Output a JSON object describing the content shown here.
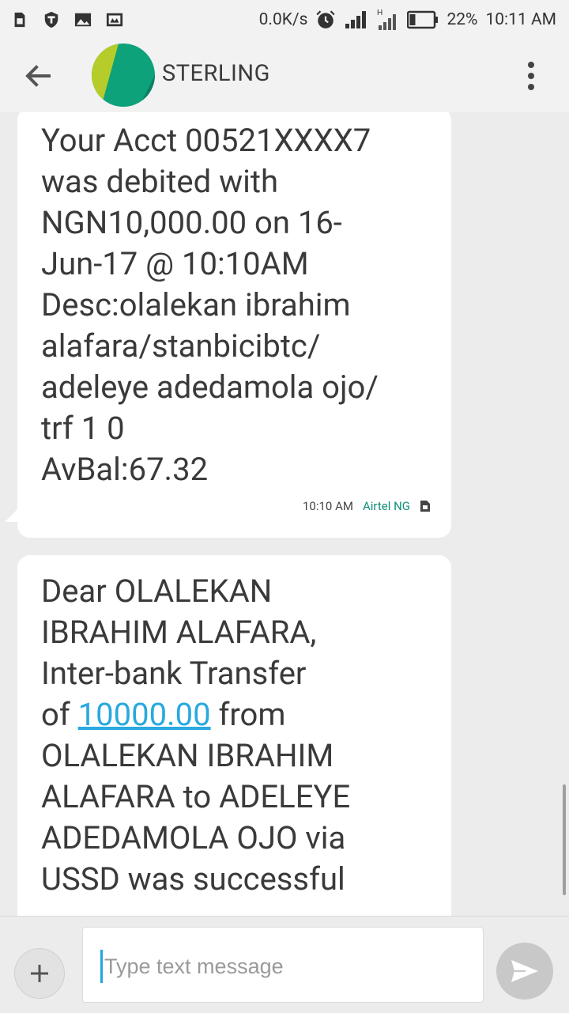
{
  "status_bar": {
    "net_speed": "0.0K/s",
    "battery_pct": "22%",
    "time": "10:11 AM",
    "icons": [
      "sim-icon",
      "shield-icon",
      "image-icon",
      "message-icon",
      "alarm-icon",
      "signal-icon",
      "signal-h-icon",
      "battery-icon"
    ]
  },
  "toolbar": {
    "title": "STERLING",
    "back_icon": "arrow-back-icon",
    "menu_icon": "more-vertical-icon"
  },
  "messages": [
    {
      "lines": [
        "Your Acct 00521XXXX7",
        "was debited with",
        "NGN10,000.00 on 16-",
        "Jun-17 @ 10:10AM",
        "Desc:olalekan ibrahim",
        "alafara/stanbicibtc/",
        "adeleye adedamola ojo/",
        "trf 1 0",
        "AvBal:67.32"
      ],
      "time": "10:10 AM",
      "carrier": "Airtel NG"
    },
    {
      "lines": [
        "Dear OLALEKAN",
        "IBRAHIM ALAFARA,",
        "Inter-bank Transfer"
      ],
      "line4_pre": "of ",
      "line4_link": "10000.00",
      "line4_post": " from",
      "lines_after": [
        "OLALEKAN IBRAHIM",
        "ALAFARA to ADELEYE",
        "ADEDAMOLA OJO via",
        "USSD was successful"
      ]
    }
  ],
  "compose": {
    "placeholder": "Type text message"
  },
  "colors": {
    "accent": "#0e8e78",
    "link": "#29a9df",
    "avatar_green": "#0ea27a",
    "avatar_lime": "#b5cc2a"
  }
}
